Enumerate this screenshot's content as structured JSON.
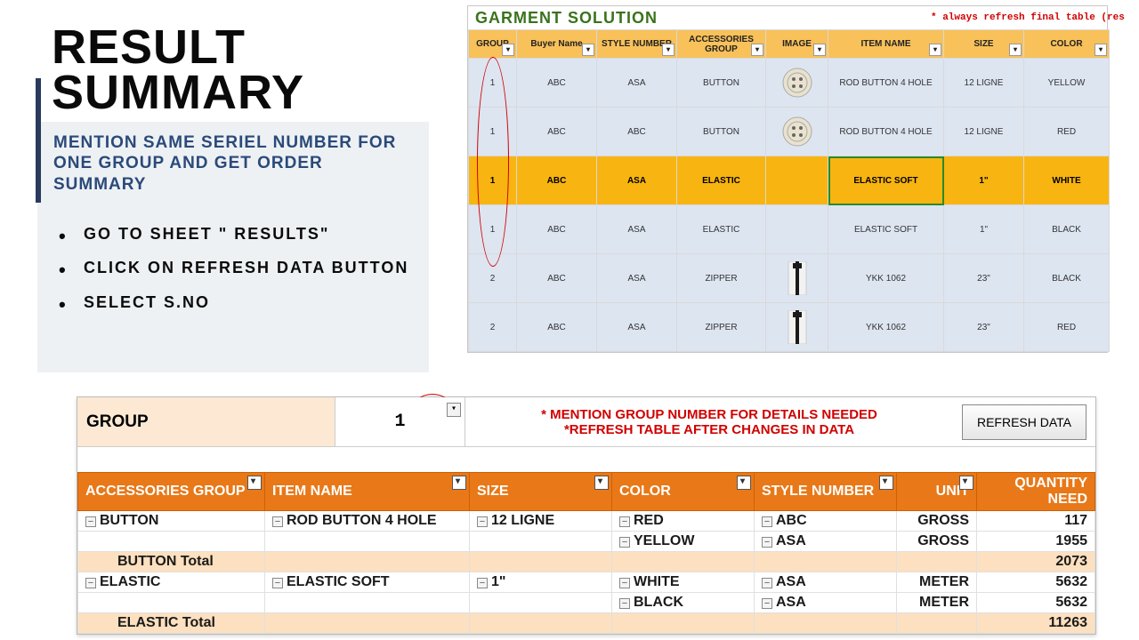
{
  "left": {
    "title_line1": "RESULT",
    "title_line2": "SUMMARY",
    "subtitle": "MENTION SAME SERIEL NUMBER FOR ONE GROUP AND GET ORDER SUMMARY",
    "bullets": [
      "GO TO SHEET \" RESULTS\"",
      "CLICK ON REFRESH DATA BUTTON",
      "SELECT S.NO"
    ]
  },
  "top_table": {
    "title": "GARMENT SOLUTION",
    "warning": "* always refresh final table (res",
    "headers": [
      "GROUP",
      "Buyer Name",
      "STYLE NUMBER",
      "ACCESSORIES GROUP",
      "IMAGE",
      "ITEM NAME",
      "SIZE",
      "COLOR"
    ],
    "rows": [
      {
        "group": "1",
        "buyer": "ABC",
        "style": "ASA",
        "acc": "BUTTON",
        "img": "button",
        "item": "ROD BUTTON 4 HOLE",
        "size": "12 LIGNE",
        "color": "YELLOW",
        "highlight": false
      },
      {
        "group": "1",
        "buyer": "ABC",
        "style": "ABC",
        "acc": "BUTTON",
        "img": "button",
        "item": "ROD BUTTON 4 HOLE",
        "size": "12 LIGNE",
        "color": "RED",
        "highlight": false
      },
      {
        "group": "1",
        "buyer": "ABC",
        "style": "ASA",
        "acc": "ELASTIC",
        "img": "",
        "item": "ELASTIC SOFT",
        "size": "1\"",
        "color": "WHITE",
        "highlight": true
      },
      {
        "group": "1",
        "buyer": "ABC",
        "style": "ASA",
        "acc": "ELASTIC",
        "img": "",
        "item": "ELASTIC SOFT",
        "size": "1\"",
        "color": "BLACK",
        "highlight": false
      },
      {
        "group": "2",
        "buyer": "ABC",
        "style": "ASA",
        "acc": "ZIPPER",
        "img": "zipper",
        "item": "YKK 1062",
        "size": "23\"",
        "color": "BLACK",
        "highlight": false
      },
      {
        "group": "2",
        "buyer": "ABC",
        "style": "ASA",
        "acc": "ZIPPER",
        "img": "zipper",
        "item": "YKK 1062",
        "size": "23\"",
        "color": "RED",
        "highlight": false
      }
    ]
  },
  "bottom": {
    "group_label": "GROUP",
    "group_value": "1",
    "hint1": "* MENTION GROUP NUMBER FOR DETAILS NEEDED",
    "hint2": "*REFRESH TABLE AFTER CHANGES IN DATA",
    "refresh_label": "REFRESH DATA",
    "headers": [
      "ACCESSORIES GROUP",
      "ITEM NAME",
      "SIZE",
      "COLOR",
      "STYLE NUMBER",
      "UNIT",
      "QUANTITY NEED"
    ],
    "rows": [
      {
        "type": "data",
        "acc": "BUTTON",
        "item": "ROD BUTTON 4 HOLE",
        "size": "12 LIGNE",
        "color": "RED",
        "style": "ABC",
        "unit": "GROSS",
        "qty": "117"
      },
      {
        "type": "data",
        "acc": "",
        "item": "",
        "size": "",
        "color": "YELLOW",
        "style": "ASA",
        "unit": "GROSS",
        "qty": "1955"
      },
      {
        "type": "total",
        "label": "BUTTON Total",
        "qty": "2073"
      },
      {
        "type": "data",
        "acc": "ELASTIC",
        "item": "ELASTIC SOFT",
        "size": "1\"",
        "color": "WHITE",
        "style": "ASA",
        "unit": "METER",
        "qty": "5632"
      },
      {
        "type": "data",
        "acc": "",
        "item": "",
        "size": "",
        "color": "BLACK",
        "style": "ASA",
        "unit": "METER",
        "qty": "5632"
      },
      {
        "type": "total",
        "label": "ELASTIC Total",
        "qty": "11263"
      }
    ]
  }
}
